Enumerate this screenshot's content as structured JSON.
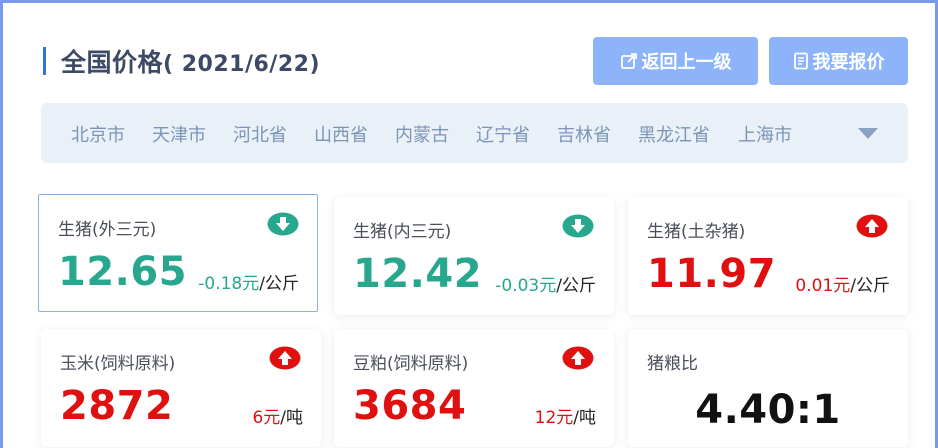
{
  "header": {
    "title": "全国价格",
    "date": "( 2021/6/22)",
    "back_label": "返回上一级",
    "quote_label": "我要报价"
  },
  "provinces": [
    "北京市",
    "天津市",
    "河北省",
    "山西省",
    "内蒙古",
    "辽宁省",
    "吉林省",
    "黑龙江省",
    "上海市"
  ],
  "cards": [
    {
      "name": "生猪(外三元)",
      "value": "12.65",
      "change": "-0.18元",
      "unit": "/公斤",
      "trend": "down",
      "trend_icon": "arrow-down-icon"
    },
    {
      "name": "生猪(内三元)",
      "value": "12.42",
      "change": "-0.03元",
      "unit": "/公斤",
      "trend": "down",
      "trend_icon": "arrow-down-icon"
    },
    {
      "name": "生猪(土杂猪)",
      "value": "11.97",
      "change": "0.01元",
      "unit": "/公斤",
      "trend": "up",
      "trend_icon": "arrow-up-icon"
    },
    {
      "name": "玉米(饲料原料)",
      "value": "2872",
      "change": "6元",
      "unit": "/吨",
      "trend": "up",
      "trend_icon": "arrow-up-icon"
    },
    {
      "name": "豆粕(饲料原料)",
      "value": "3684",
      "change": "12元",
      "unit": "/吨",
      "trend": "up",
      "trend_icon": "arrow-up-icon"
    },
    {
      "name": "猪粮比",
      "value": "4.40:1"
    }
  ],
  "colors": {
    "accent": "#3a6fe0",
    "button": "#8db4fb",
    "down": "#27a88e",
    "up": "#e01010"
  }
}
